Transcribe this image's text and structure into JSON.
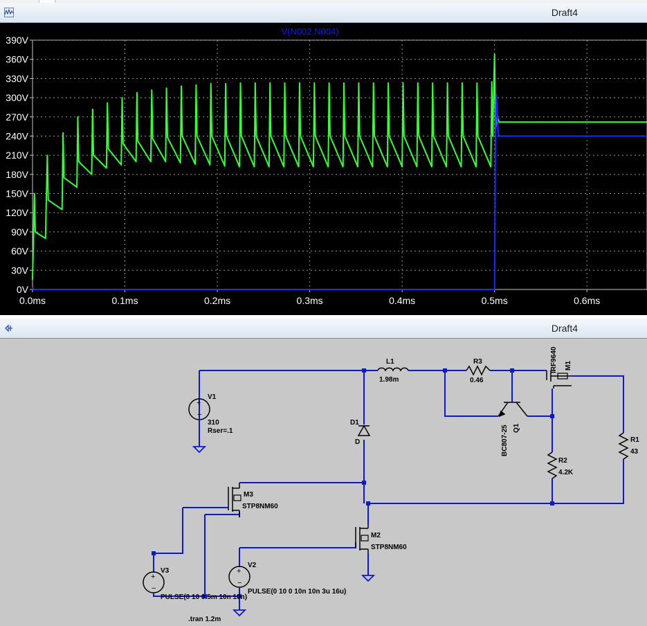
{
  "plot_window": {
    "title": "Draft4",
    "icon": "waveform-icon",
    "trace_label": "V(N002,N004)"
  },
  "schematic_window": {
    "title": "Draft4",
    "icon": "schematic-icon"
  },
  "colors": {
    "plot_bg": "#000000",
    "grid": "#9a9a9a",
    "axis_text": "#ffffff",
    "trace_green": "#33ff33",
    "trace_blue": "#1a2bff",
    "trace_label": "#0a1aff",
    "wire": "#0a1acc",
    "schematic_bg": "#c8c8c8"
  },
  "chart_data": {
    "type": "line",
    "title": "V(N002,N004)",
    "xlabel": "",
    "ylabel": "",
    "x_unit": "ms",
    "y_unit": "V",
    "xlim": [
      0,
      0.665
    ],
    "ylim": [
      0,
      390
    ],
    "x_ticks": [
      "0.0ms",
      "0.1ms",
      "0.2ms",
      "0.3ms",
      "0.4ms",
      "0.5ms",
      "0.6ms"
    ],
    "x_tick_values": [
      0,
      0.1,
      0.2,
      0.3,
      0.4,
      0.5,
      0.6
    ],
    "y_ticks": [
      "0V",
      "30V",
      "60V",
      "90V",
      "120V",
      "150V",
      "180V",
      "210V",
      "240V",
      "270V",
      "300V",
      "330V",
      "360V",
      "390V"
    ],
    "y_tick_values": [
      0,
      30,
      60,
      90,
      120,
      150,
      180,
      210,
      240,
      270,
      300,
      330,
      360,
      390
    ],
    "grid": true,
    "series": [
      {
        "color": "#33ff33",
        "x": [
          0,
          0.002,
          0.003,
          0.014,
          0.016,
          0.017,
          0.032,
          0.033,
          0.034,
          0.048,
          0.049,
          0.05,
          0.064,
          0.065,
          0.066,
          0.08,
          0.081,
          0.082,
          0.096,
          0.097,
          0.098,
          0.112,
          0.113,
          0.114,
          0.128,
          0.129,
          0.13,
          0.144,
          0.145,
          0.146,
          0.16,
          0.161,
          0.162,
          0.176,
          0.177,
          0.178,
          0.192,
          0.193,
          0.194,
          0.208,
          0.209,
          0.21,
          0.224,
          0.225,
          0.226,
          0.24,
          0.241,
          0.242,
          0.256,
          0.257,
          0.258,
          0.272,
          0.273,
          0.274,
          0.288,
          0.289,
          0.29,
          0.304,
          0.305,
          0.306,
          0.32,
          0.321,
          0.322,
          0.336,
          0.337,
          0.338,
          0.352,
          0.353,
          0.354,
          0.368,
          0.369,
          0.37,
          0.384,
          0.385,
          0.386,
          0.4,
          0.401,
          0.402,
          0.416,
          0.417,
          0.418,
          0.432,
          0.433,
          0.434,
          0.448,
          0.449,
          0.45,
          0.464,
          0.465,
          0.466,
          0.48,
          0.481,
          0.482,
          0.496,
          0.497,
          0.498,
          0.5,
          0.501,
          0.503,
          0.505,
          0.665
        ],
        "values": [
          15,
          150,
          90,
          80,
          210,
          140,
          125,
          245,
          175,
          160,
          270,
          200,
          180,
          282,
          210,
          190,
          292,
          220,
          195,
          300,
          228,
          200,
          308,
          232,
          200,
          312,
          236,
          200,
          315,
          238,
          198,
          318,
          240,
          196,
          320,
          240,
          195,
          322,
          240,
          193,
          322,
          240,
          192,
          323,
          240,
          192,
          323,
          240,
          192,
          323,
          240,
          192,
          323,
          240,
          192,
          323,
          240,
          192,
          323,
          240,
          192,
          323,
          240,
          192,
          323,
          240,
          192,
          323,
          240,
          192,
          323,
          240,
          192,
          323,
          240,
          192,
          323,
          240,
          192,
          323,
          240,
          192,
          323,
          240,
          192,
          323,
          240,
          192,
          323,
          240,
          192,
          323,
          240,
          192,
          325,
          240,
          368,
          250,
          270,
          262,
          262
        ]
      },
      {
        "color": "#1a2bff",
        "x": [
          0,
          0.0005,
          0.001,
          0.499,
          0.5,
          0.501,
          0.502,
          0.504,
          0.505,
          0.507,
          0.665
        ],
        "values": [
          0,
          3,
          0,
          0,
          0,
          240,
          305,
          245,
          240,
          240,
          240
        ]
      }
    ]
  },
  "schematic": {
    "labels": {
      "v1_name": "V1",
      "v1_value": "310",
      "v1_rser": "Rser=.1",
      "l1_name": "L1",
      "l1_value": "1.98m",
      "r3_name": "R3",
      "r3_value": "0.46",
      "m1_model": "IRF9640",
      "m1_name": "M1",
      "d1_name": "D1",
      "d1_model": "D",
      "q1_model": "BC807-25",
      "q1_name": "Q1",
      "r1_name": "R1",
      "r1_value": "43",
      "r2_name": "R2",
      "r2_value": "4.2K",
      "m3_name": "M3",
      "m3_model": "STP8NM60",
      "m2_name": "M2",
      "m2_model": "STP8NM60",
      "v3_name": "V3",
      "v3_value": "PULSE(0 10 0.5m 10n 10n)",
      "v2_name": "V2",
      "v2_value": "PULSE(0 10 0 10n 10n 3u 16u)",
      "directive": ".tran 1.2m"
    }
  }
}
